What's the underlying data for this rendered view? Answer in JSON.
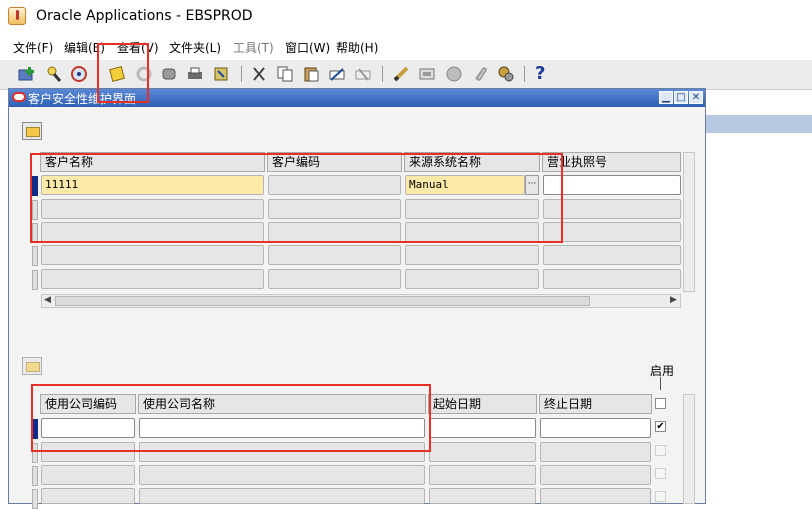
{
  "app": {
    "title": "Oracle Applications - EBSPROD"
  },
  "menu": [
    "文件(F)",
    "编辑(E)",
    "查看(V)",
    "文件夹(L)",
    "工具(T)",
    "窗口(W)",
    "帮助(H)"
  ],
  "toolbar": {
    "icons": [
      "new-icon",
      "find-icon",
      "navigator-icon",
      "save-icon",
      "next-step-icon",
      "switch-responsibility-icon",
      "print-icon",
      "close-form-icon",
      "cut-icon",
      "copy-icon",
      "paste-icon",
      "clear-record-icon",
      "delete-record-icon",
      "edit-field-icon",
      "zoom-icon",
      "translations-icon",
      "attachments-icon",
      "folder-tools-icon"
    ],
    "help": "?"
  },
  "window": {
    "title": "客户安全性维护界面",
    "buttons": {
      "minimize": "▁",
      "maximize": "□",
      "close": "✕"
    }
  },
  "upper_table": {
    "columns": [
      "客户名称",
      "客户编码",
      "来源系统名称",
      "营业执照号"
    ],
    "rows": [
      [
        "11111",
        "",
        "Manual",
        ""
      ],
      [
        "",
        "",
        "",
        ""
      ],
      [
        "",
        "",
        "",
        ""
      ],
      [
        "",
        "",
        "",
        ""
      ],
      [
        "",
        "",
        "",
        ""
      ]
    ],
    "lov_button": "···"
  },
  "lower_table": {
    "columns": [
      "使用公司编码",
      "使用公司名称",
      "起始日期",
      "终止日期"
    ],
    "enabled_label": "启用",
    "rows": [
      [
        "",
        "",
        "",
        ""
      ],
      [
        "",
        "",
        "",
        ""
      ],
      [
        "",
        "",
        "",
        ""
      ],
      [
        "",
        "",
        "",
        ""
      ]
    ],
    "enabled": [
      false,
      true,
      false,
      false,
      false
    ]
  },
  "colors": {
    "accent": "#2f5fb2",
    "highlight": "#e8302a",
    "current_field": "#fde9a8"
  }
}
